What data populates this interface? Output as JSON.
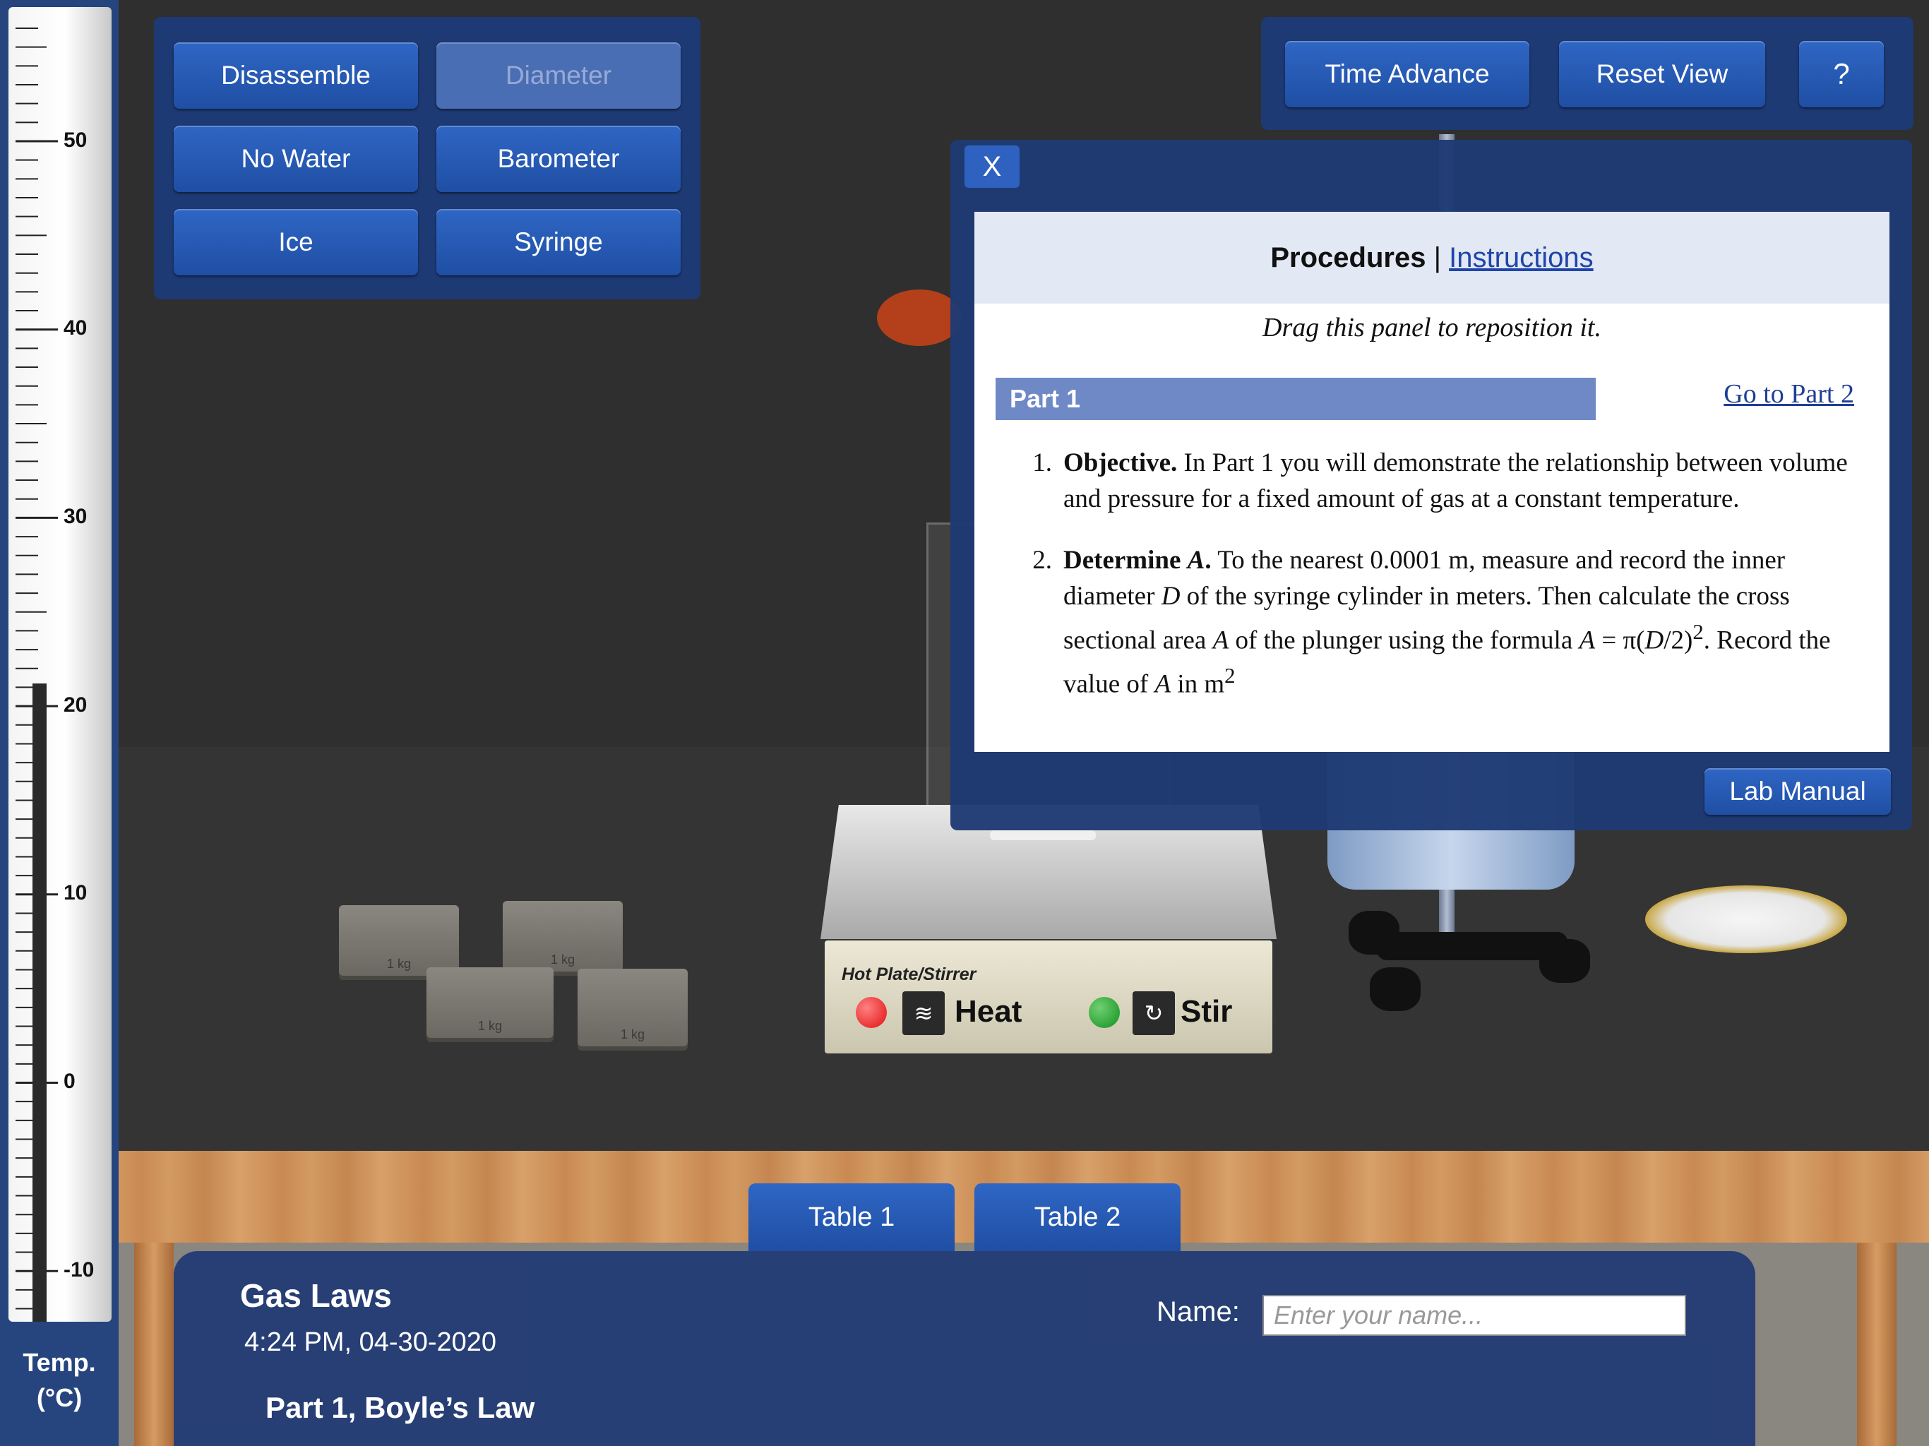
{
  "thermometer": {
    "tick_labels": [
      "50",
      "40",
      "30",
      "20",
      "10",
      "0",
      "-10"
    ],
    "caption_line1": "Temp.",
    "caption_line2": "(°C)",
    "reading_celsius": 20
  },
  "equipment_buttons": {
    "disassemble": "Disassemble",
    "diameter": "Diameter",
    "no_water": "No Water",
    "barometer": "Barometer",
    "ice": "Ice",
    "syringe": "Syringe"
  },
  "top_right_buttons": {
    "time_advance": "Time Advance",
    "reset_view": "Reset View",
    "help": "?"
  },
  "procedure_panel": {
    "close": "X",
    "header_bold": "Procedures",
    "header_sep": " | ",
    "header_link": "Instructions",
    "drag_hint": "Drag this panel to reposition it.",
    "part_label": "Part 1",
    "goto_link": "Go to Part 2",
    "steps": [
      {
        "num": "1.",
        "title": "Objective.",
        "text": " In Part 1 you will demonstrate the relationship between volume and pressure for a fixed amount of gas at a constant temperature."
      },
      {
        "num": "2.",
        "title": "Determine ",
        "title_var": "A",
        "title_end": ".",
        "text_a": " To the nearest 0.0001 m, measure and record the inner diameter ",
        "var_d": "D",
        "text_b": " of the syringe cylinder in meters. Then calculate the cross sectional area ",
        "var_a1": "A",
        "text_c": " of the plunger using the formula ",
        "var_a2": "A",
        "text_d": " = π(",
        "var_d2": "D",
        "text_e": "/2)",
        "sup1": "2",
        "text_f": ". Record the value of ",
        "var_a3": "A",
        "text_g": " in m",
        "sup2": "2"
      }
    ],
    "lab_manual": "Lab Manual"
  },
  "hot_plate": {
    "title": "Hot Plate/Stirrer",
    "heat_label": "Heat",
    "stir_label": "Stir",
    "heat_icon": "heat-waves-icon",
    "stir_icon": "rotate-icon",
    "heat_led_color": "#e01010",
    "stir_led_color": "#109020"
  },
  "weights": [
    "1 kg",
    "1 kg",
    "1 kg",
    "1 kg"
  ],
  "tabs": [
    "Table 1",
    "Table 2"
  ],
  "footer": {
    "title": "Gas Laws",
    "timestamp": "4:24 PM, 04-30-2020",
    "part": "Part 1, Boyle’s Law",
    "name_label": "Name:",
    "name_placeholder": "Enter your name...",
    "name_value": ""
  },
  "colors": {
    "panel_blue": "#1e3a74",
    "button_blue": "#2f66c4",
    "part_bar": "#6f89c6"
  }
}
